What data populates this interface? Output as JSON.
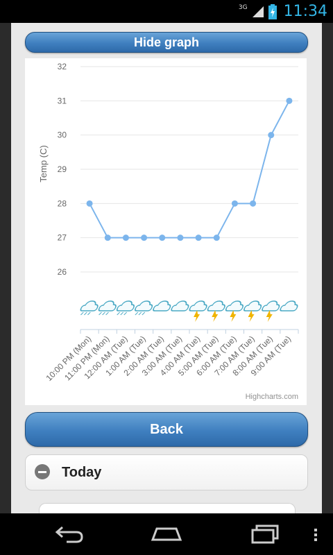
{
  "status_bar": {
    "network_type": "3G",
    "time": "11:34"
  },
  "buttons": {
    "hide_graph_label": "Hide graph",
    "back_label": "Back"
  },
  "section": {
    "today_label": "Today"
  },
  "chart_data": {
    "type": "line",
    "ylabel": "Temp (C)",
    "ylim": [
      26,
      32
    ],
    "yticks": [
      "32",
      "31",
      "30",
      "29",
      "28",
      "27",
      "26"
    ],
    "categories": [
      "10:00 PM (Mon)",
      "11:00 PM (Mon)",
      "12:00 AM (Tue)",
      "1:00 AM (Tue)",
      "2:00 AM (Tue)",
      "3:00 AM (Tue)",
      "4:00 AM (Tue)",
      "5:00 AM (Tue)",
      "6:00 AM (Tue)",
      "7:00 AM (Tue)",
      "8:00 AM (Tue)",
      "9:00 AM (Tue)"
    ],
    "series": [
      {
        "values": [
          28,
          27,
          27,
          27,
          27,
          27,
          27,
          27,
          28,
          28,
          30,
          31
        ],
        "color": "#7cb5ec"
      }
    ],
    "weather_icons": [
      "rain-cloud-icon",
      "rain-cloud-icon",
      "rain-cloud-icon",
      "rain-cloud-icon",
      "cloud-icon",
      "cloud-icon",
      "thunderstorm-icon",
      "thunderstorm-icon",
      "thunderstorm-icon",
      "thunderstorm-icon",
      "thunderstorm-icon",
      "cloud-icon"
    ],
    "credit": "Highcharts.com",
    "grid": true,
    "legend": false
  },
  "colors": {
    "accent": "#33b5e5",
    "button": "#3f7fbf",
    "series": "#7cb5ec"
  }
}
